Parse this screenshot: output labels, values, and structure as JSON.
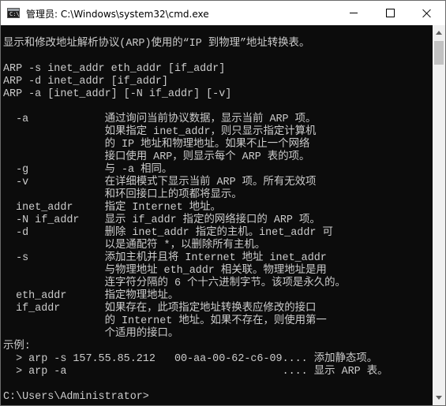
{
  "window": {
    "title": "管理员: C:\\Windows\\system32\\cmd.exe",
    "icon": "cmd-icon"
  },
  "console": {
    "lines": [
      "",
      "显示和修改地址解析协议(ARP)使用的“IP 到物理”地址转换表。",
      "",
      "ARP -s inet_addr eth_addr [if_addr]",
      "ARP -d inet_addr [if_addr]",
      "ARP -a [inet_addr] [-N if_addr] [-v]",
      "",
      "  -a            通过询问当前协议数据，显示当前 ARP 项。",
      "                如果指定 inet_addr，则只显示指定计算机",
      "                的 IP 地址和物理地址。如果不止一个网络",
      "                接口使用 ARP，则显示每个 ARP 表的项。",
      "  -g            与 -a 相同。",
      "  -v            在详细模式下显示当前 ARP 项。所有无效项",
      "                和环回接口上的项都将显示。",
      "  inet_addr     指定 Internet 地址。",
      "  -N if_addr    显示 if_addr 指定的网络接口的 ARP 项。",
      "  -d            删除 inet_addr 指定的主机。inet_addr 可",
      "                以是通配符 *，以删除所有主机。",
      "  -s            添加主机并且将 Internet 地址 inet_addr",
      "                与物理地址 eth_addr 相关联。物理地址是用",
      "                连字符分隔的 6 个十六进制字节。该项是永久的。",
      "  eth_addr      指定物理地址。",
      "  if_addr       如果存在，此项指定地址转换表应修改的接口",
      "                的 Internet 地址。如果不存在，则使用第一",
      "                个适用的接口。",
      "示例:",
      "  > arp -s 157.55.85.212   00-aa-00-62-c6-09.... 添加静态项。",
      "  > arp -a                                  .... 显示 ARP 表。",
      "",
      "C:\\Users\\Administrator>"
    ]
  },
  "colors": {
    "console_background": "#0c0c0c",
    "console_text": "#cccccc",
    "titlebar_background": "#ffffff"
  }
}
